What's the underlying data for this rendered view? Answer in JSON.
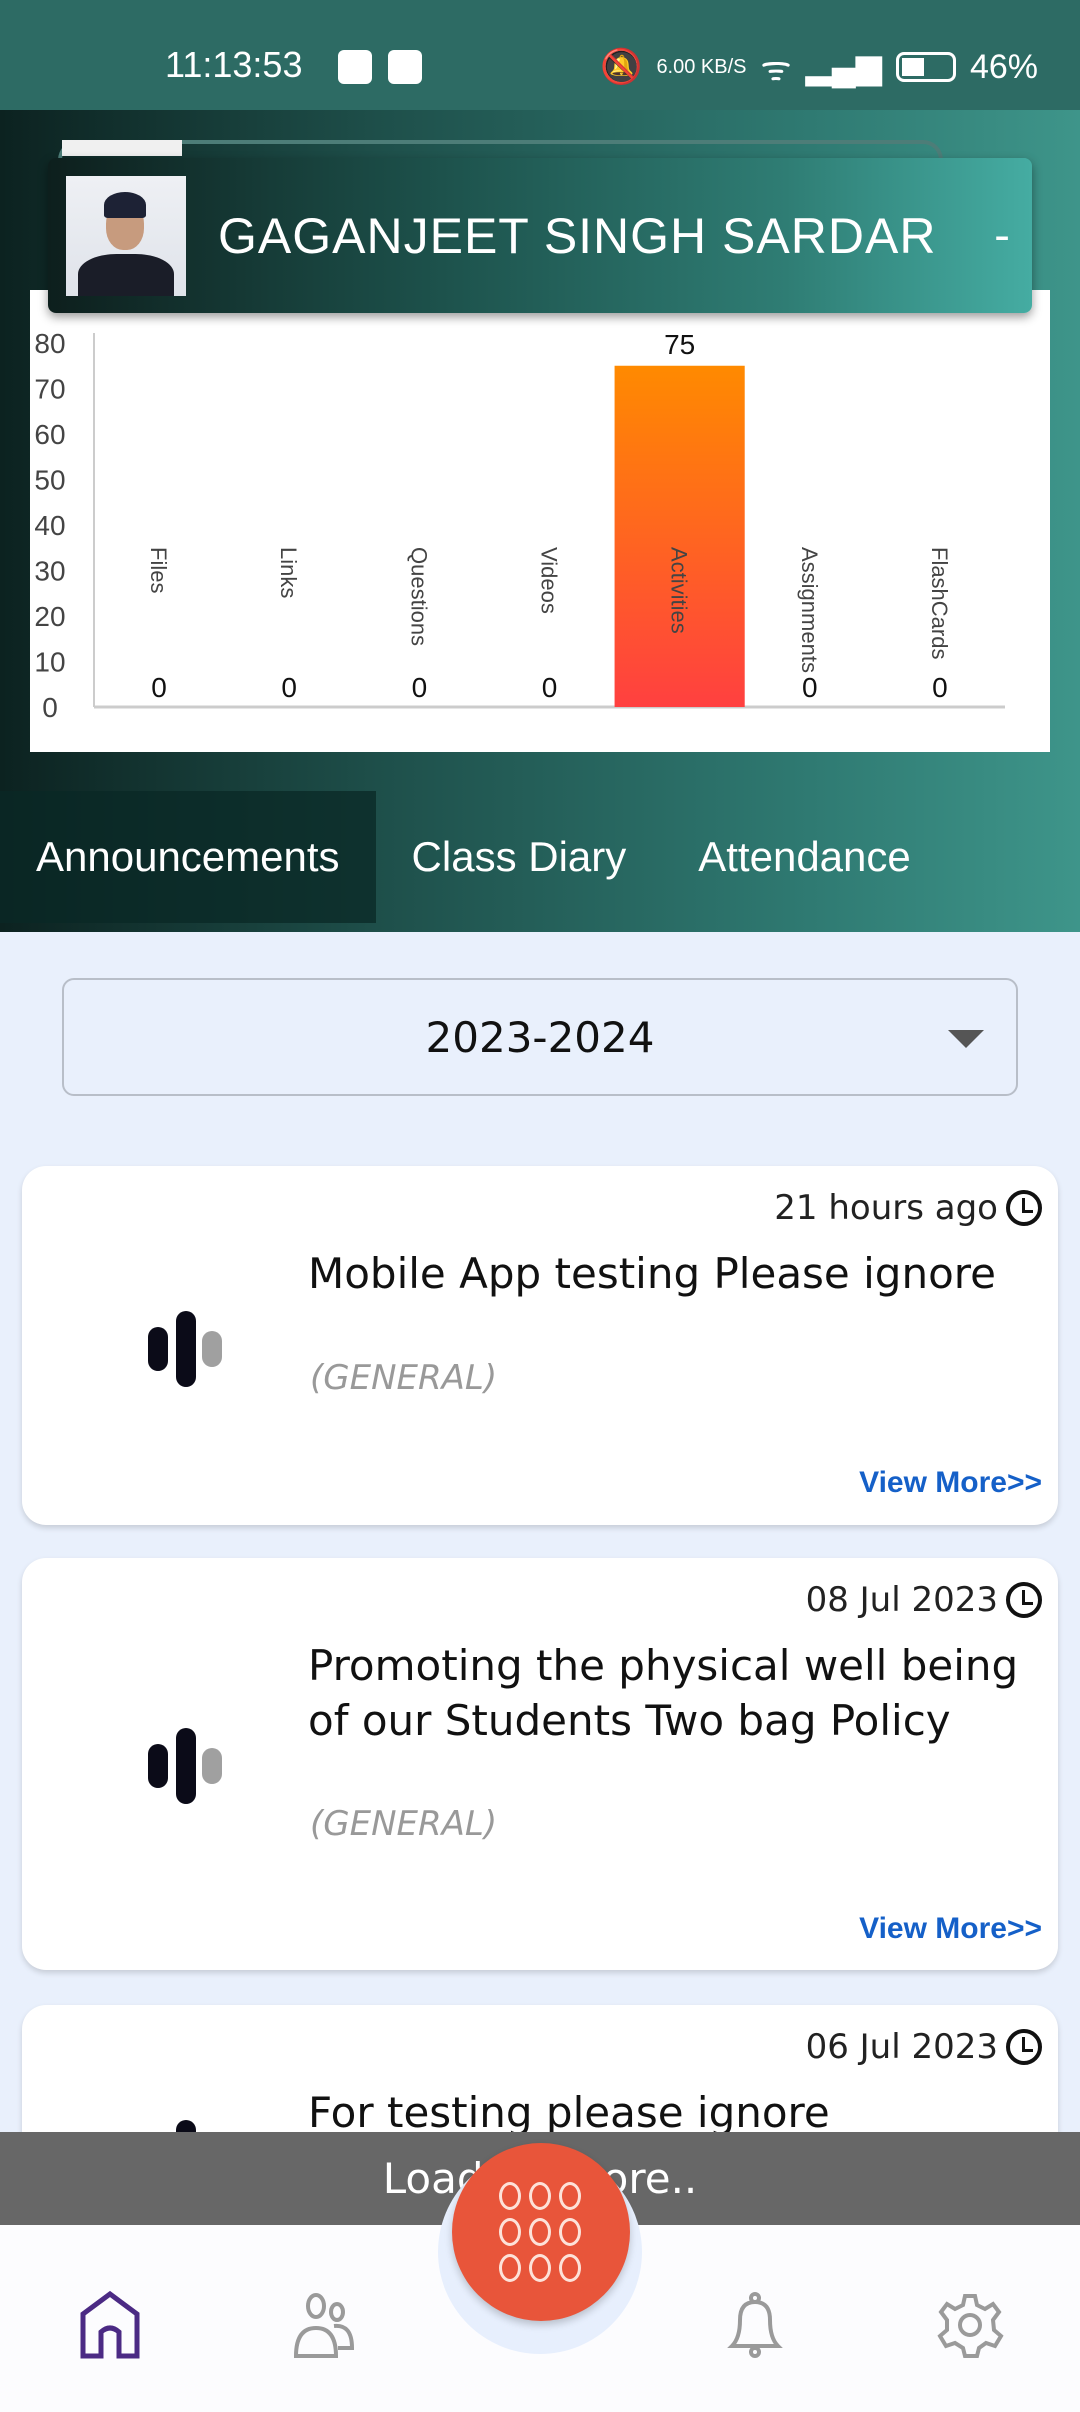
{
  "status_bar": {
    "time": "11:13:53",
    "net_speed": "6.00 KB/S",
    "battery": "46%"
  },
  "profile": {
    "name": "GAGANJEET SINGH SARDAR",
    "suffix": "-"
  },
  "chart_data": {
    "type": "bar",
    "categories": [
      "Files",
      "Links",
      "Questions",
      "Videos",
      "Activities",
      "Assignments",
      "FlashCards"
    ],
    "values": [
      0,
      0,
      0,
      0,
      75,
      0,
      0
    ],
    "ylim": [
      0,
      80
    ],
    "yticks": [
      0,
      10,
      20,
      30,
      40,
      50,
      60,
      70,
      80
    ],
    "bar_gradient": [
      "#ff8a00",
      "#ff4040"
    ]
  },
  "tabs": [
    {
      "label": "Announcements",
      "active": true
    },
    {
      "label": "Class Diary"
    },
    {
      "label": "Attendance"
    }
  ],
  "year_select": {
    "value": "2023-2024"
  },
  "announcements": [
    {
      "date": "21 hours ago",
      "title": "Mobile App testing Please ignore",
      "category": "(GENERAL)",
      "link": "View More>>"
    },
    {
      "date": "08 Jul 2023",
      "title": "Promoting the physical well being of our Students Two bag Policy",
      "category": "(GENERAL)",
      "link": "View More>>"
    },
    {
      "date": "06 Jul 2023",
      "title": "For testing please ignore"
    }
  ],
  "toast": "Loading more..",
  "nav": [
    "home-icon",
    "users-icon",
    "apps-icon",
    "bell-icon",
    "settings-icon"
  ],
  "colors": {
    "accent": "#e8553a",
    "nav_active": "#4b2a84",
    "link": "#1560c8"
  }
}
